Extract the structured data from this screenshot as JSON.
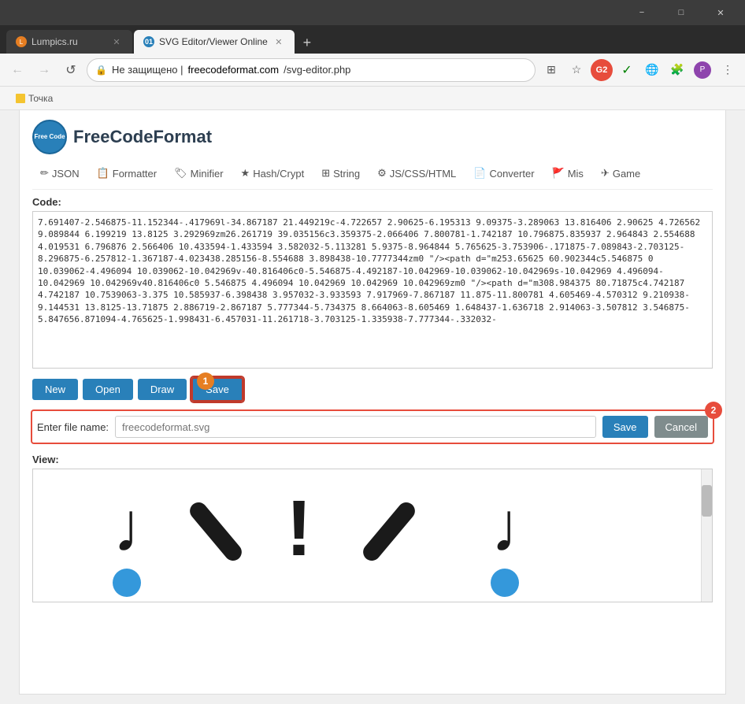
{
  "browser": {
    "tabs": [
      {
        "id": "lumpics",
        "label": "Lumpics.ru",
        "favicon_text": "L",
        "favicon_color": "#e67e22",
        "active": false
      },
      {
        "id": "svg-editor",
        "label": "SVG Editor/Viewer Online",
        "favicon_text": "01",
        "favicon_color": "#2980b9",
        "active": true
      }
    ],
    "new_tab_label": "+",
    "window_controls": {
      "minimize": "−",
      "maximize": "□",
      "close": "✕"
    }
  },
  "nav": {
    "back_icon": "←",
    "forward_icon": "→",
    "reload_icon": "↺",
    "address_protocol": "Не защищено | ",
    "address_domain": "freecodeformat.com",
    "address_path": "/svg-editor.php",
    "translate_icon": "⊞",
    "star_icon": "☆",
    "extension1": "G2",
    "extension2": "✓",
    "globe_icon": "🌐",
    "puzzle_icon": "🧩",
    "menu_icon": "≡",
    "more_icon": "⋮"
  },
  "bookmark": {
    "folder_label": "Точка"
  },
  "site": {
    "logo_text": "Free\nCode",
    "title": "FreeCodeFormat"
  },
  "menu_items": [
    {
      "icon": "✏",
      "label": "JSON"
    },
    {
      "icon": "📋",
      "label": "Formatter"
    },
    {
      "icon": "🏷",
      "label": "Minifier"
    },
    {
      "icon": "★",
      "label": "Hash/Crypt"
    },
    {
      "icon": "⊞",
      "label": "String"
    },
    {
      "icon": "⚙",
      "label": "JS/CSS/HTML"
    },
    {
      "icon": "📄",
      "label": "Converter"
    },
    {
      "icon": "🚩",
      "label": "Mis"
    },
    {
      "icon": "✈",
      "label": "Game"
    }
  ],
  "code_section": {
    "label": "Code:",
    "content": "7.691407-2.546875-11.152344-.417969l-34.867187 21.449219c-4.722657 2.90625-6.195313 9.09375-3.289063 13.816406 2.90625 4.726562 9.089844 6.199219 13.8125 3.292969zm26.261719 39.035156c3.359375-2.066406 7.800781-1.742187 10.796875.835937 2.964843 2.554688 4.019531 6.796876 2.566406 10.433594-1.433594 3.582032-5.113281 5.9375-8.964844 5.765625-3.753906-.171875-7.089843-2.703125-8.296875-6.257812-1.367187-4.023438.285156-8.554688 3.898438-10.7777344zm0 \"/><path d=\"m253.65625 60.902344c5.546875 0 10.039062-4.496094 10.039062-10.042969v-40.816406c0-5.546875-4.492187-10.042969-10.039062-10.042969s-10.042969 4.496094-10.042969 10.042969v40.816406c0 5.546875 4.496094 10.042969 10.042969 10.042969zm0 \"/><path d=\"m308.984375 80.71875c4.742187 4.742187 10.7539063-3.375 10.585937-6.398438 3.957032-3.933593 7.917969-7.867187 11.875-11.800781 4.605469-4.570312 9.210938-9.144531 13.8125-13.71875 2.886719-2.867187 5.777344-5.734375 8.664063-8.605469 1.648437-1.636718 2.914063-3.507812 3.546875-5.847656.871094-4.765625-1.998431-6.457031-11.261718-3.703125-1.335938-7.777344-.332032-"
  },
  "action_buttons": [
    {
      "id": "new",
      "label": "New"
    },
    {
      "id": "open",
      "label": "Open"
    },
    {
      "id": "draw",
      "label": "Draw"
    },
    {
      "id": "save",
      "label": "Save",
      "highlighted": true
    }
  ],
  "badge1": {
    "number": "1",
    "color": "#e67e22"
  },
  "save_dialog": {
    "label": "Enter file name:",
    "placeholder": "freecodeformat.svg",
    "save_btn": "Save",
    "cancel_btn": "Cancel"
  },
  "badge2": {
    "number": "2",
    "color": "#e74c3c"
  },
  "view_section": {
    "label": "View:"
  }
}
